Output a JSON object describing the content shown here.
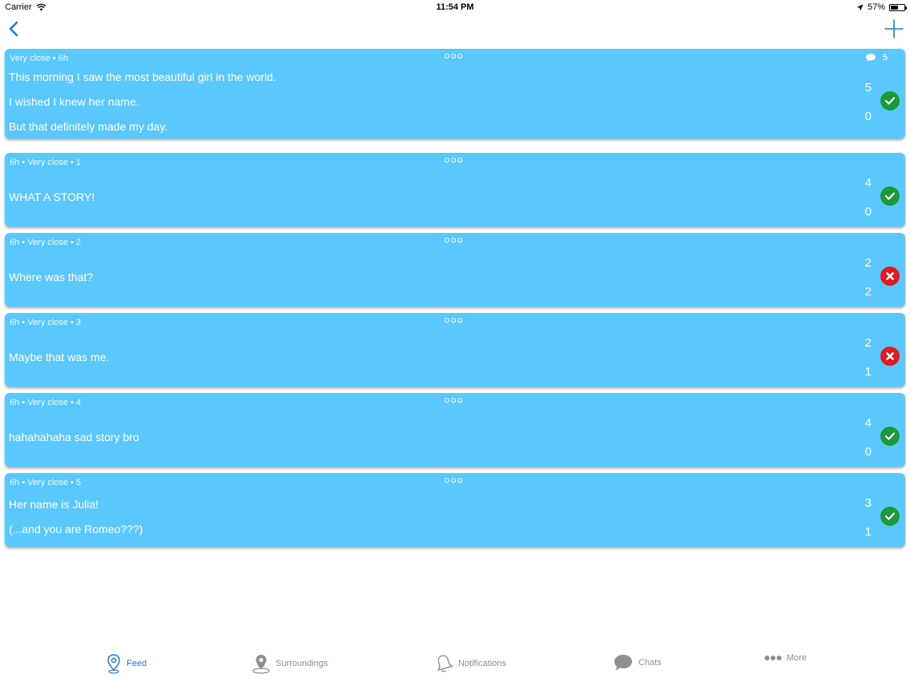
{
  "status_bar": {
    "carrier": "Carrier",
    "time": "11:54 PM",
    "battery_percent": "57%",
    "battery_level": 0.57
  },
  "nav": {
    "back_icon": "chevron-left-icon",
    "add_icon": "plus-icon"
  },
  "colors": {
    "card": "#5ac8fa",
    "accent": "#1e7be6",
    "approve": "#1a9a3a",
    "reject": "#e01b24"
  },
  "posts": [
    {
      "meta": "Very close • 6h",
      "comments": "5",
      "lines": [
        "This morning I saw the most beautiful girl in the world.",
        "I wished I knew her name.",
        "But that definitely made my day."
      ],
      "upvotes": "5",
      "downvotes": "0",
      "verdict": "check"
    },
    {
      "meta": "6h • Very close • 1",
      "lines": [
        "WHAT A STORY!"
      ],
      "upvotes": "4",
      "downvotes": "0",
      "verdict": "check"
    },
    {
      "meta": "6h • Very close • 2",
      "lines": [
        "Where was that?"
      ],
      "upvotes": "2",
      "downvotes": "2",
      "verdict": "cross"
    },
    {
      "meta": "6h • Very close • 3",
      "lines": [
        "Maybe that was me."
      ],
      "upvotes": "2",
      "downvotes": "1",
      "verdict": "cross"
    },
    {
      "meta": "6h • Very close • 4",
      "lines": [
        "hahahahaha sad story bro"
      ],
      "upvotes": "4",
      "downvotes": "0",
      "verdict": "check"
    },
    {
      "meta": "6h • Very close • 5",
      "lines": [
        "Her name is Julia!",
        "(...and you are Romeo???)"
      ],
      "upvotes": "3",
      "downvotes": "1",
      "verdict": "check"
    }
  ],
  "tabs": [
    {
      "label": "Feed",
      "icon": "map-pin-icon",
      "active": true
    },
    {
      "label": "Surroundings",
      "icon": "location-icon",
      "active": false
    },
    {
      "label": "Notifications",
      "icon": "bell-icon",
      "active": false
    },
    {
      "label": "Chats",
      "icon": "chat-bubble-icon",
      "active": false
    },
    {
      "label": "More",
      "icon": "more-dots-icon",
      "active": false
    }
  ]
}
